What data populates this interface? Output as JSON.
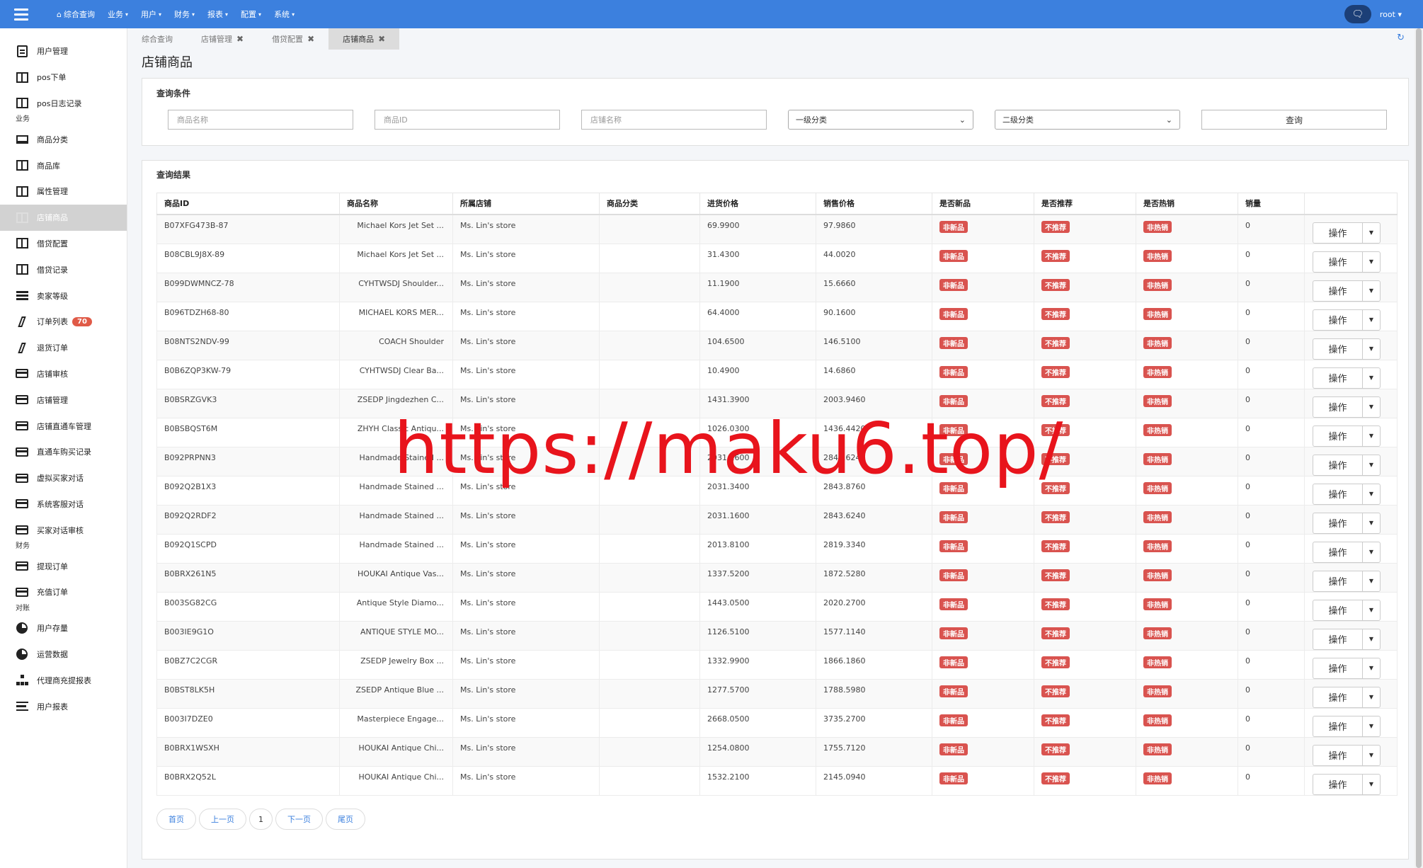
{
  "topbar": {
    "nav": [
      {
        "label": "综合查询",
        "icon": "home-icon",
        "dropdown": false
      },
      {
        "label": "业务",
        "dropdown": true
      },
      {
        "label": "用户",
        "dropdown": true
      },
      {
        "label": "财务",
        "dropdown": true
      },
      {
        "label": "报表",
        "dropdown": true
      },
      {
        "label": "配置",
        "dropdown": true
      },
      {
        "label": "系统",
        "dropdown": true
      }
    ],
    "user": "root",
    "accent": "#3c80de"
  },
  "sidebar": {
    "items": [
      {
        "label": "用户管理",
        "icon": "file-text-icon"
      },
      {
        "label": "pos下单",
        "icon": "columns-icon"
      },
      {
        "label": "pos日志记录",
        "icon": "columns-icon"
      },
      {
        "group": "业务"
      },
      {
        "label": "商品分类",
        "icon": "laptop-icon"
      },
      {
        "label": "商品库",
        "icon": "columns-icon"
      },
      {
        "label": "属性管理",
        "icon": "columns-icon"
      },
      {
        "label": "店铺商品",
        "icon": "columns-icon",
        "active": true
      },
      {
        "label": "借贷配置",
        "icon": "columns-icon"
      },
      {
        "label": "借贷记录",
        "icon": "columns-icon"
      },
      {
        "label": "卖家等级",
        "icon": "list-icon"
      },
      {
        "label": "订单列表",
        "icon": "slash-icon",
        "badge": "70"
      },
      {
        "label": "退货订单",
        "icon": "slash-icon"
      },
      {
        "label": "店铺审核",
        "icon": "credit-card-icon"
      },
      {
        "label": "店铺管理",
        "icon": "credit-card-icon"
      },
      {
        "label": "店铺直通车管理",
        "icon": "credit-card-icon"
      },
      {
        "label": "直通车购买记录",
        "icon": "credit-card-icon"
      },
      {
        "label": "虚拟买家对话",
        "icon": "credit-card-icon"
      },
      {
        "label": "系统客服对话",
        "icon": "credit-card-icon"
      },
      {
        "label": "买家对话审核",
        "icon": "credit-card-icon"
      },
      {
        "group": "财务"
      },
      {
        "label": "提现订单",
        "icon": "credit-card-icon"
      },
      {
        "label": "充值订单",
        "icon": "credit-card-icon"
      },
      {
        "group": "对账"
      },
      {
        "label": "用户存量",
        "icon": "pie-chart-icon"
      },
      {
        "label": "运营数据",
        "icon": "pie-chart-icon"
      },
      {
        "label": "代理商充提报表",
        "icon": "sitemap-icon"
      },
      {
        "label": "用户报表",
        "icon": "align-left-icon"
      }
    ]
  },
  "tabs": [
    {
      "label": "综合查询",
      "closable": false
    },
    {
      "label": "店铺管理",
      "closable": true
    },
    {
      "label": "借贷配置",
      "closable": true
    },
    {
      "label": "店铺商品",
      "closable": true,
      "active": true
    }
  ],
  "page_title": "店铺商品",
  "filter": {
    "title": "查询条件",
    "product_name_placeholder": "商品名称",
    "product_id_placeholder": "商品ID",
    "shop_name_placeholder": "店铺名称",
    "category1_selected": "一级分类",
    "category2_selected": "二级分类",
    "query_button": "查询"
  },
  "result": {
    "title": "查询结果",
    "columns": [
      "商品ID",
      "商品名称",
      "所属店铺",
      "商品分类",
      "进货价格",
      "销售价格",
      "是否新品",
      "是否推荐",
      "是否热销",
      "销量",
      ""
    ],
    "new_tag": "非新品",
    "recommend_tag": "不推荐",
    "hot_tag": "非热销",
    "op_label": "操作",
    "rows": [
      {
        "id": "B07XFG473B-87",
        "name": "Michael Kors Jet Set ...",
        "shop": "Ms. Lin's store",
        "category": "",
        "cost": "69.9900",
        "price": "97.9860",
        "sales": "0"
      },
      {
        "id": "B08CBL9J8X-89",
        "name": "Michael Kors Jet Set ...",
        "shop": "Ms. Lin's store",
        "category": "",
        "cost": "31.4300",
        "price": "44.0020",
        "sales": "0"
      },
      {
        "id": "B099DWMNCZ-78",
        "name": "CYHTWSDJ Shoulder...",
        "shop": "Ms. Lin's store",
        "category": "",
        "cost": "11.1900",
        "price": "15.6660",
        "sales": "0"
      },
      {
        "id": "B096TDZH68-80",
        "name": "MICHAEL KORS MER...",
        "shop": "Ms. Lin's store",
        "category": "",
        "cost": "64.4000",
        "price": "90.1600",
        "sales": "0"
      },
      {
        "id": "B08NTS2NDV-99",
        "name": "COACH Shoulder",
        "shop": "Ms. Lin's store",
        "category": "",
        "cost": "104.6500",
        "price": "146.5100",
        "sales": "0"
      },
      {
        "id": "B0B6ZQP3KW-79",
        "name": "CYHTWSDJ Clear Ba...",
        "shop": "Ms. Lin's store",
        "category": "",
        "cost": "10.4900",
        "price": "14.6860",
        "sales": "0"
      },
      {
        "id": "B0BSRZGVK3",
        "name": "ZSEDP Jingdezhen C...",
        "shop": "Ms. Lin's store",
        "category": "",
        "cost": "1431.3900",
        "price": "2003.9460",
        "sales": "0"
      },
      {
        "id": "B0BSBQST6M",
        "name": "ZHYH Classic Antiqu...",
        "shop": "Ms. Lin's store",
        "category": "",
        "cost": "1026.0300",
        "price": "1436.4420",
        "sales": "0"
      },
      {
        "id": "B092PRPNN3",
        "name": "Handmade Stained ...",
        "shop": "Ms. Lin's store",
        "category": "",
        "cost": "2031.1600",
        "price": "2843.6240",
        "sales": "0"
      },
      {
        "id": "B092Q2B1X3",
        "name": "Handmade Stained ...",
        "shop": "Ms. Lin's store",
        "category": "",
        "cost": "2031.3400",
        "price": "2843.8760",
        "sales": "0"
      },
      {
        "id": "B092Q2RDF2",
        "name": "Handmade Stained ...",
        "shop": "Ms. Lin's store",
        "category": "",
        "cost": "2031.1600",
        "price": "2843.6240",
        "sales": "0"
      },
      {
        "id": "B092Q1SCPD",
        "name": "Handmade Stained ...",
        "shop": "Ms. Lin's store",
        "category": "",
        "cost": "2013.8100",
        "price": "2819.3340",
        "sales": "0"
      },
      {
        "id": "B0BRX261N5",
        "name": "HOUKAI Antique Vas...",
        "shop": "Ms. Lin's store",
        "category": "",
        "cost": "1337.5200",
        "price": "1872.5280",
        "sales": "0"
      },
      {
        "id": "B003SG82CG",
        "name": "Antique Style Diamo...",
        "shop": "Ms. Lin's store",
        "category": "",
        "cost": "1443.0500",
        "price": "2020.2700",
        "sales": "0"
      },
      {
        "id": "B003IE9G1O",
        "name": "ANTIQUE STYLE MO...",
        "shop": "Ms. Lin's store",
        "category": "",
        "cost": "1126.5100",
        "price": "1577.1140",
        "sales": "0"
      },
      {
        "id": "B0BZ7C2CGR",
        "name": "ZSEDP Jewelry Box ...",
        "shop": "Ms. Lin's store",
        "category": "",
        "cost": "1332.9900",
        "price": "1866.1860",
        "sales": "0"
      },
      {
        "id": "B0BST8LK5H",
        "name": "ZSEDP Antique Blue ...",
        "shop": "Ms. Lin's store",
        "category": "",
        "cost": "1277.5700",
        "price": "1788.5980",
        "sales": "0"
      },
      {
        "id": "B003I7DZE0",
        "name": "Masterpiece Engage...",
        "shop": "Ms. Lin's store",
        "category": "",
        "cost": "2668.0500",
        "price": "3735.2700",
        "sales": "0"
      },
      {
        "id": "B0BRX1WSXH",
        "name": "HOUKAI Antique Chi...",
        "shop": "Ms. Lin's store",
        "category": "",
        "cost": "1254.0800",
        "price": "1755.7120",
        "sales": "0"
      },
      {
        "id": "B0BRX2Q52L",
        "name": "HOUKAI Antique Chi...",
        "shop": "Ms. Lin's store",
        "category": "",
        "cost": "1532.2100",
        "price": "2145.0940",
        "sales": "0"
      }
    ]
  },
  "pager": {
    "first": "首页",
    "prev": "上一页",
    "current": "1",
    "next": "下一页",
    "last": "尾页"
  },
  "watermark": "https://maku6.top/"
}
